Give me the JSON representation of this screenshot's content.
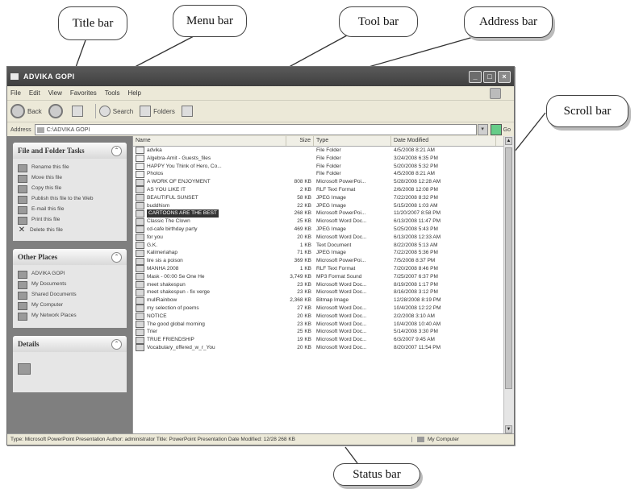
{
  "callouts": {
    "title_bar": "Title bar",
    "menu_bar": "Menu bar",
    "tool_bar": "Tool bar",
    "address_bar": "Address bar",
    "scroll_bar": "Scroll bar",
    "status_bar": "Status bar"
  },
  "window": {
    "title": "ADVIKA GOPI",
    "menu": [
      "File",
      "Edit",
      "View",
      "Favorites",
      "Tools",
      "Help"
    ],
    "toolbar": {
      "back": "Back",
      "search": "Search",
      "folders": "Folders"
    },
    "address": {
      "label": "Address",
      "value": "C:\\ADVIKA GOPI",
      "go": "Go"
    }
  },
  "taskpane": {
    "file_folder_tasks": {
      "title": "File and Folder Tasks",
      "items": [
        "Rename this file",
        "Move this file",
        "Copy this file",
        "Publish this file to the Web",
        "E-mail this file",
        "Print this file",
        "Delete this file"
      ]
    },
    "other_places": {
      "title": "Other Places",
      "items": [
        "ADVIKA GOPI",
        "My Documents",
        "Shared Documents",
        "My Computer",
        "My Network Places"
      ]
    },
    "details": {
      "title": "Details"
    }
  },
  "columns": {
    "name": "Name",
    "size": "Size",
    "type": "Type",
    "date": "Date Modified"
  },
  "files": [
    {
      "name": "advika",
      "size": "",
      "type": "File Folder",
      "date": "4/5/2008 8:21 AM"
    },
    {
      "name": "Algebra-Amit - Guests_files",
      "size": "",
      "type": "File Folder",
      "date": "3/24/2008 6:35 PM"
    },
    {
      "name": "HAPPY You Think of Hero, Co...",
      "size": "",
      "type": "File Folder",
      "date": "5/20/2008 5:32 PM"
    },
    {
      "name": "Photos",
      "size": "",
      "type": "File Folder",
      "date": "4/5/2008 8:21 AM"
    },
    {
      "name": "A WORK OF ENJOYMENT",
      "size": "808 KB",
      "type": "Microsoft PowerPoi...",
      "date": "5/28/2008 12:28 AM"
    },
    {
      "name": "AS YOU LIKE IT",
      "size": "2 KB",
      "type": "RLF Text Format",
      "date": "2/6/2008 12:08 PM"
    },
    {
      "name": "BEAUTIFUL SUNSET",
      "size": "58 KB",
      "type": "JPEG Image",
      "date": "7/22/2008 8:32 PM"
    },
    {
      "name": "buddhism",
      "size": "22 KB",
      "type": "JPEG Image",
      "date": "5/15/2008 1:03 AM"
    },
    {
      "name": "CARTOONS ARE THE BEST",
      "size": "268 KB",
      "type": "Microsoft PowerPoi...",
      "date": "11/20/2007 8:58 PM"
    },
    {
      "name": "Classic The Clown",
      "size": "25 KB",
      "type": "Microsoft Word Doc...",
      "date": "6/13/2008 11:47 PM"
    },
    {
      "name": "cd-cafe birthday party",
      "size": "469 KB",
      "type": "JPEG Image",
      "date": "5/25/2008 5:43 PM"
    },
    {
      "name": "for you",
      "size": "20 KB",
      "type": "Microsoft Word Doc...",
      "date": "6/13/2008 12:33 AM"
    },
    {
      "name": "G.K.",
      "size": "1 KB",
      "type": "Text Document",
      "date": "8/22/2008 5:13 AM"
    },
    {
      "name": "Kalimeriahap",
      "size": "71 KB",
      "type": "JPEG Image",
      "date": "7/22/2008 5:36 PM"
    },
    {
      "name": "lire sis a poison",
      "size": "369 KB",
      "type": "Microsoft PowerPoi...",
      "date": "7/5/2008 8:37 PM"
    },
    {
      "name": "MANHA 2008",
      "size": "1 KB",
      "type": "RLF Text Format",
      "date": "7/20/2008 8:46 PM"
    },
    {
      "name": "Mask - 00:00 Se One He",
      "size": "3,749 KB",
      "type": "MP3 Format Sound",
      "date": "7/25/2007 6:37 PM"
    },
    {
      "name": "meet shakespun",
      "size": "23 KB",
      "type": "Microsoft Word Doc...",
      "date": "8/19/2008 1:17 PM"
    },
    {
      "name": "meet shakespun - fix verge",
      "size": "23 KB",
      "type": "Microsoft Word Doc...",
      "date": "8/16/2008 3:12 PM"
    },
    {
      "name": "mullRainbow",
      "size": "2,368 KB",
      "type": "Bitmap Image",
      "date": "12/28/2008 8:19 PM"
    },
    {
      "name": "my selection of poems",
      "size": "27 KB",
      "type": "Microsoft Word Doc...",
      "date": "10/4/2008 12:22 PM"
    },
    {
      "name": "NOTICE",
      "size": "20 KB",
      "type": "Microsoft Word Doc...",
      "date": "2/2/2008 3:10 AM"
    },
    {
      "name": "The good global morning",
      "size": "23 KB",
      "type": "Microsoft Word Doc...",
      "date": "10/4/2008 10:40 AM"
    },
    {
      "name": "Trier",
      "size": "25 KB",
      "type": "Microsoft Word Doc...",
      "date": "5/14/2008 3:30 PM"
    },
    {
      "name": "TRUE FRIENDSHIP",
      "size": "19 KB",
      "type": "Microsoft Word Doc...",
      "date": "6/3/2007 9:45 AM"
    },
    {
      "name": "Vocabulary_offered_w_r_You",
      "size": "20 KB",
      "type": "Microsoft Word Doc...",
      "date": "8/20/2007 11:54 PM"
    }
  ],
  "selected_index": 8,
  "status": {
    "text": "Type: Microsoft PowerPoint Presentation Author: administrator Title: PowerPoint Presentation Date Modified: 12/28 268 KB",
    "location": "My Computer"
  }
}
